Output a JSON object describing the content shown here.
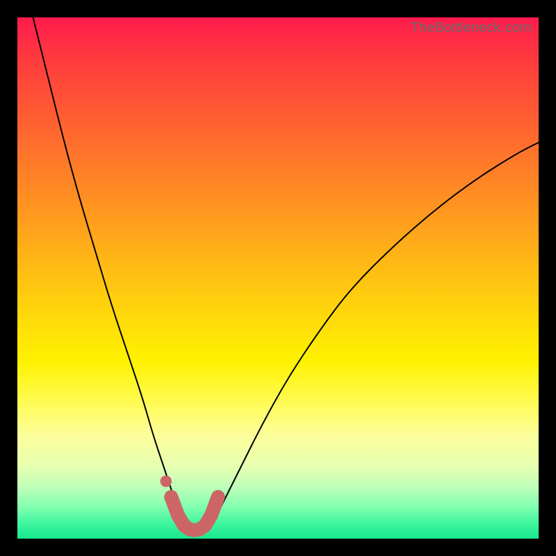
{
  "watermark": "TheBottleneck.com",
  "colors": {
    "curve": "#000000",
    "marker": "#cc6666",
    "gradient_top": "#ff1a4d",
    "gradient_bottom": "#18e88f"
  },
  "chart_data": {
    "type": "line",
    "title": "",
    "xlabel": "",
    "ylabel": "",
    "xlim": [
      0,
      100
    ],
    "ylim": [
      0,
      100
    ],
    "grid": false,
    "series": [
      {
        "name": "bottleneck-curve",
        "x": [
          3,
          6,
          9,
          12,
          15,
          18,
          21,
          24,
          26,
          28,
          30,
          31,
          32,
          33,
          34,
          35,
          36,
          38,
          40,
          43,
          47,
          52,
          58,
          64,
          72,
          80,
          88,
          96,
          100
        ],
        "y": [
          100,
          88,
          76,
          65,
          55,
          45,
          36,
          27,
          20,
          14,
          8,
          5,
          3,
          2,
          1.5,
          1.5,
          2,
          4,
          8,
          14,
          22,
          31,
          40,
          48,
          56,
          63,
          69,
          74,
          76
        ]
      }
    ],
    "annotations": [
      {
        "name": "marker-dot",
        "shape": "circle",
        "x": 28.5,
        "y": 11,
        "r": 1.1
      },
      {
        "name": "marker-u",
        "shape": "path",
        "points_x": [
          29.5,
          30.8,
          32.0,
          33.0,
          34.0,
          35.0,
          36.0,
          37.2,
          38.5
        ],
        "points_y": [
          8.0,
          4.5,
          2.5,
          1.8,
          1.6,
          1.8,
          2.5,
          4.5,
          8.0
        ]
      }
    ]
  }
}
